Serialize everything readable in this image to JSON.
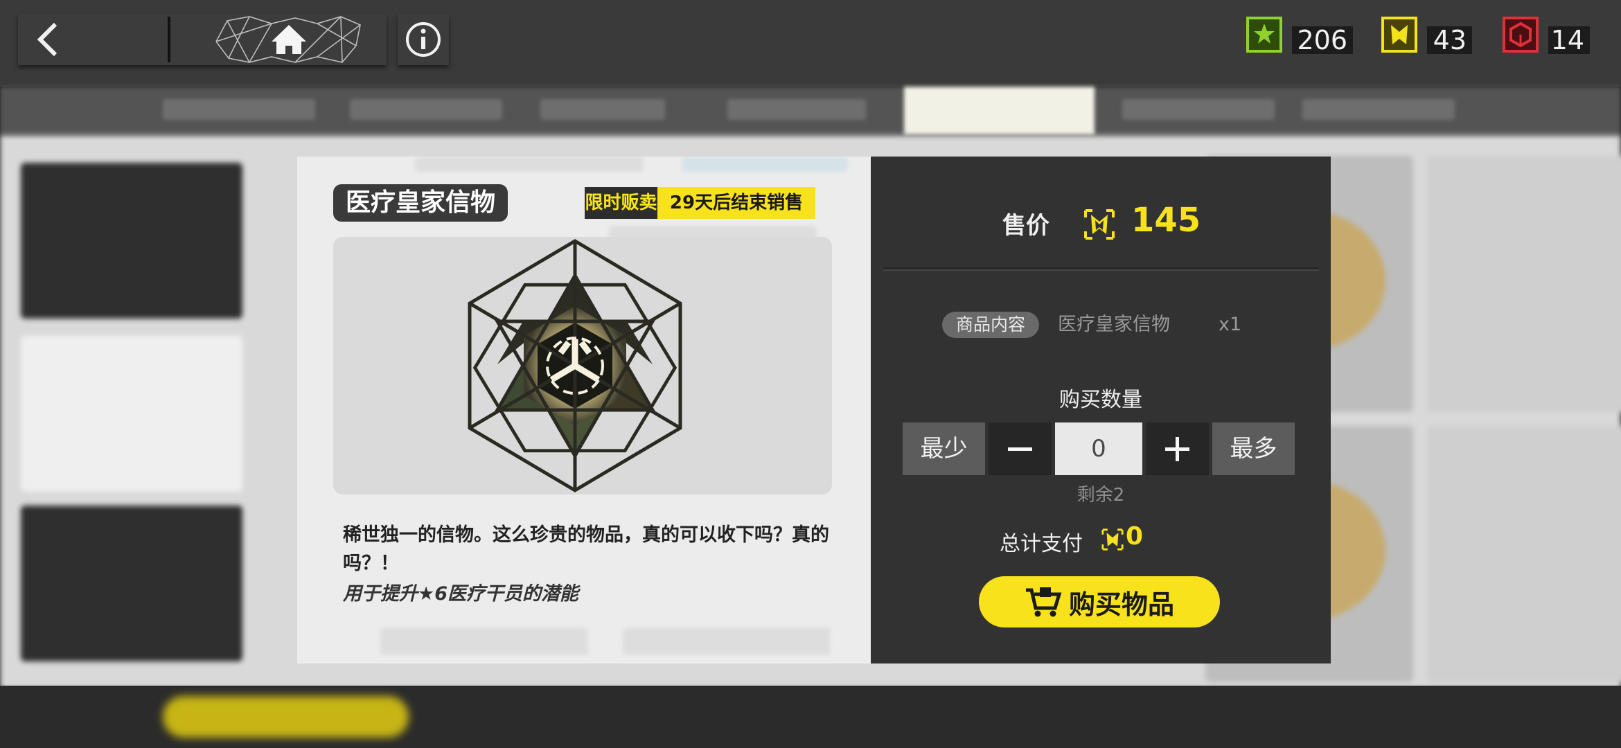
{
  "currencies": [
    {
      "name": "green-token",
      "value": "206",
      "color": "#8fd22a"
    },
    {
      "name": "yellow-token",
      "value": "43",
      "color": "#f4e21b"
    },
    {
      "name": "red-token",
      "value": "14",
      "color": "#e0313a"
    }
  ],
  "item": {
    "name": "医疗皇家信物",
    "limited_label": "限时贩卖",
    "end_label": "29天后结束销售",
    "description": "稀世独一的信物。这么珍贵的物品，真的可以收下吗？真的吗？！",
    "hint": "用于提升★6医疗干员的潜能"
  },
  "purchase": {
    "price_label": "售价",
    "price": "145",
    "content_label": "商品内容",
    "content_name": "医疗皇家信物",
    "content_qty": "x1",
    "qty_label": "购买数量",
    "min_label": "最少",
    "max_label": "最多",
    "qty": "0",
    "remaining": "剩余2",
    "total_label": "总计支付",
    "total": "0",
    "buy_label": "购买物品"
  },
  "icons": {
    "back": "chevron-left-icon",
    "home": "home-icon",
    "info": "info-icon",
    "price": "certificate-icon",
    "buy": "cart-icon"
  },
  "colors": {
    "accent_yellow": "#f7e21c",
    "panel_dark": "#323232",
    "panel_light": "#ececec"
  }
}
